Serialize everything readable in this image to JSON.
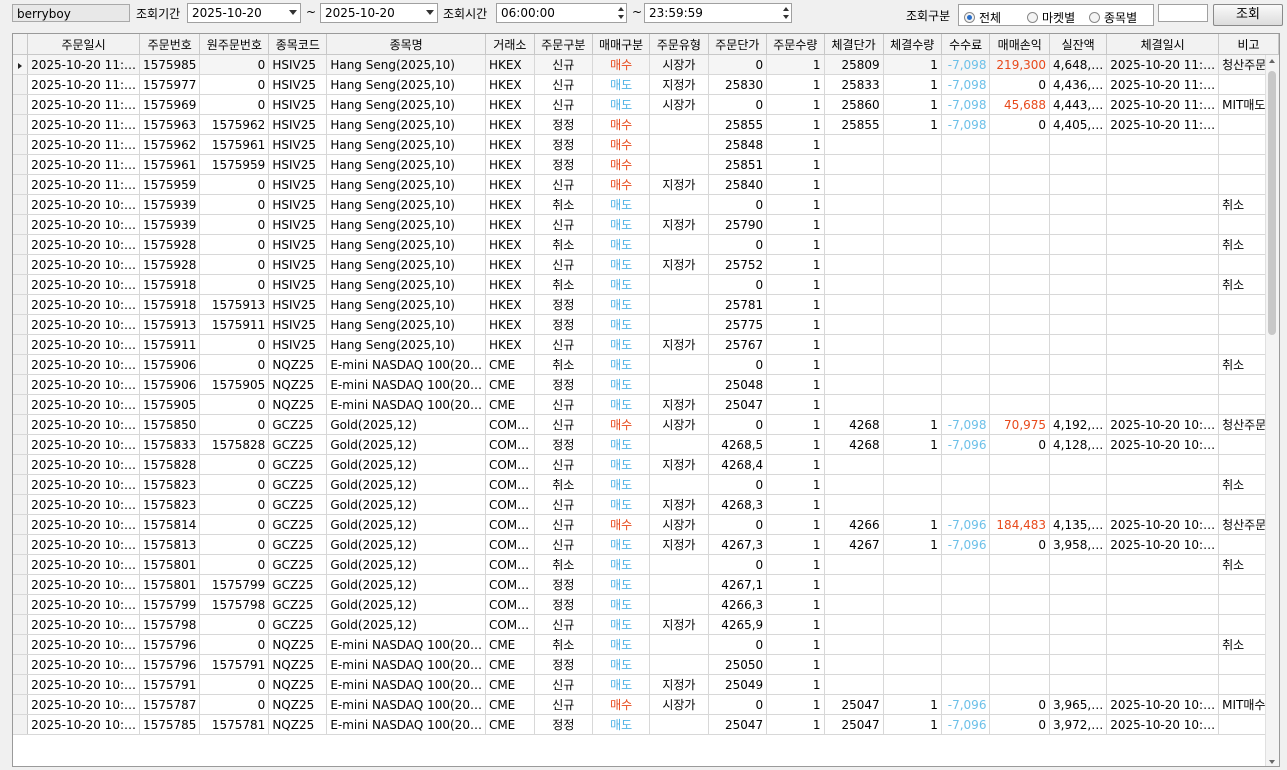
{
  "toolbar": {
    "account": "berryboy",
    "period_label": "조회기간",
    "date_from": "2025-10-20",
    "tilde": "~",
    "date_to": "2025-10-20",
    "time_label": "조회시간",
    "time_from": "06:00:00",
    "time_to": "23:59:59",
    "category_label": "조회구분",
    "radio_all": "전체",
    "radio_market": "마켓별",
    "radio_symbol": "종목별",
    "search_button": "조회"
  },
  "colors": {
    "buy": "#e8491b",
    "sell": "#4fb3e6",
    "fee": "#6cc0e8"
  },
  "columns": [
    "주문일시",
    "주문번호",
    "원주문번호",
    "종목코드",
    "종목명",
    "거래소",
    "주문구분",
    "매매구분",
    "주문유형",
    "주문단가",
    "주문수량",
    "체결단가",
    "체결수량",
    "수수료",
    "매매손익",
    "실잔액",
    "체결일시",
    "비고"
  ],
  "rows": [
    [
      "2025-10-20 11:…",
      "1575985",
      "0",
      "HSIV25",
      "Hang Seng(2025,10)",
      "HKEX",
      "신규",
      "매수",
      "시장가",
      "0",
      "1",
      "25809",
      "1",
      "-7,098",
      "219,300",
      "4,648,…",
      "2025-10-20 11:…",
      "청산주문"
    ],
    [
      "2025-10-20 11:…",
      "1575977",
      "0",
      "HSIV25",
      "Hang Seng(2025,10)",
      "HKEX",
      "신규",
      "매도",
      "지정가",
      "25830",
      "1",
      "25833",
      "1",
      "-7,098",
      "0",
      "4,436,…",
      "2025-10-20 11:…",
      ""
    ],
    [
      "2025-10-20 11:…",
      "1575969",
      "0",
      "HSIV25",
      "Hang Seng(2025,10)",
      "HKEX",
      "신규",
      "매도",
      "시장가",
      "0",
      "1",
      "25860",
      "1",
      "-7,098",
      "45,688",
      "4,443,…",
      "2025-10-20 11:…",
      "MIT매도"
    ],
    [
      "2025-10-20 11:…",
      "1575963",
      "1575962",
      "HSIV25",
      "Hang Seng(2025,10)",
      "HKEX",
      "정정",
      "매수",
      "",
      "25855",
      "1",
      "25855",
      "1",
      "-7,098",
      "0",
      "4,405,…",
      "2025-10-20 11:…",
      ""
    ],
    [
      "2025-10-20 11:…",
      "1575962",
      "1575961",
      "HSIV25",
      "Hang Seng(2025,10)",
      "HKEX",
      "정정",
      "매수",
      "",
      "25848",
      "1",
      "",
      "",
      "",
      "",
      "",
      "",
      ""
    ],
    [
      "2025-10-20 11:…",
      "1575961",
      "1575959",
      "HSIV25",
      "Hang Seng(2025,10)",
      "HKEX",
      "정정",
      "매수",
      "",
      "25851",
      "1",
      "",
      "",
      "",
      "",
      "",
      "",
      ""
    ],
    [
      "2025-10-20 11:…",
      "1575959",
      "0",
      "HSIV25",
      "Hang Seng(2025,10)",
      "HKEX",
      "신규",
      "매수",
      "지정가",
      "25840",
      "1",
      "",
      "",
      "",
      "",
      "",
      "",
      ""
    ],
    [
      "2025-10-20 10:…",
      "1575939",
      "0",
      "HSIV25",
      "Hang Seng(2025,10)",
      "HKEX",
      "취소",
      "매도",
      "",
      "0",
      "1",
      "",
      "",
      "",
      "",
      "",
      "",
      "취소"
    ],
    [
      "2025-10-20 10:…",
      "1575939",
      "0",
      "HSIV25",
      "Hang Seng(2025,10)",
      "HKEX",
      "신규",
      "매도",
      "지정가",
      "25790",
      "1",
      "",
      "",
      "",
      "",
      "",
      "",
      ""
    ],
    [
      "2025-10-20 10:…",
      "1575928",
      "0",
      "HSIV25",
      "Hang Seng(2025,10)",
      "HKEX",
      "취소",
      "매도",
      "",
      "0",
      "1",
      "",
      "",
      "",
      "",
      "",
      "",
      "취소"
    ],
    [
      "2025-10-20 10:…",
      "1575928",
      "0",
      "HSIV25",
      "Hang Seng(2025,10)",
      "HKEX",
      "신규",
      "매도",
      "지정가",
      "25752",
      "1",
      "",
      "",
      "",
      "",
      "",
      "",
      ""
    ],
    [
      "2025-10-20 10:…",
      "1575918",
      "0",
      "HSIV25",
      "Hang Seng(2025,10)",
      "HKEX",
      "취소",
      "매도",
      "",
      "0",
      "1",
      "",
      "",
      "",
      "",
      "",
      "",
      "취소"
    ],
    [
      "2025-10-20 10:…",
      "1575918",
      "1575913",
      "HSIV25",
      "Hang Seng(2025,10)",
      "HKEX",
      "정정",
      "매도",
      "",
      "25781",
      "1",
      "",
      "",
      "",
      "",
      "",
      "",
      ""
    ],
    [
      "2025-10-20 10:…",
      "1575913",
      "1575911",
      "HSIV25",
      "Hang Seng(2025,10)",
      "HKEX",
      "정정",
      "매도",
      "",
      "25775",
      "1",
      "",
      "",
      "",
      "",
      "",
      "",
      ""
    ],
    [
      "2025-10-20 10:…",
      "1575911",
      "0",
      "HSIV25",
      "Hang Seng(2025,10)",
      "HKEX",
      "신규",
      "매도",
      "지정가",
      "25767",
      "1",
      "",
      "",
      "",
      "",
      "",
      "",
      ""
    ],
    [
      "2025-10-20 10:…",
      "1575906",
      "0",
      "NQZ25",
      "E-mini NASDAQ 100(20…",
      "CME",
      "취소",
      "매도",
      "",
      "0",
      "1",
      "",
      "",
      "",
      "",
      "",
      "",
      "취소"
    ],
    [
      "2025-10-20 10:…",
      "1575906",
      "1575905",
      "NQZ25",
      "E-mini NASDAQ 100(20…",
      "CME",
      "정정",
      "매도",
      "",
      "25048",
      "1",
      "",
      "",
      "",
      "",
      "",
      "",
      ""
    ],
    [
      "2025-10-20 10:…",
      "1575905",
      "0",
      "NQZ25",
      "E-mini NASDAQ 100(20…",
      "CME",
      "신규",
      "매도",
      "지정가",
      "25047",
      "1",
      "",
      "",
      "",
      "",
      "",
      "",
      ""
    ],
    [
      "2025-10-20 10:…",
      "1575850",
      "0",
      "GCZ25",
      "Gold(2025,12)",
      "COM…",
      "신규",
      "매수",
      "시장가",
      "0",
      "1",
      "4268",
      "1",
      "-7,098",
      "70,975",
      "4,192,…",
      "2025-10-20 10:…",
      "청산주문"
    ],
    [
      "2025-10-20 10:…",
      "1575833",
      "1575828",
      "GCZ25",
      "Gold(2025,12)",
      "COM…",
      "정정",
      "매도",
      "",
      "4268,5",
      "1",
      "4268",
      "1",
      "-7,096",
      "0",
      "4,128,…",
      "2025-10-20 10:…",
      ""
    ],
    [
      "2025-10-20 10:…",
      "1575828",
      "0",
      "GCZ25",
      "Gold(2025,12)",
      "COM…",
      "신규",
      "매도",
      "지정가",
      "4268,4",
      "1",
      "",
      "",
      "",
      "",
      "",
      "",
      ""
    ],
    [
      "2025-10-20 10:…",
      "1575823",
      "0",
      "GCZ25",
      "Gold(2025,12)",
      "COM…",
      "취소",
      "매도",
      "",
      "0",
      "1",
      "",
      "",
      "",
      "",
      "",
      "",
      "취소"
    ],
    [
      "2025-10-20 10:…",
      "1575823",
      "0",
      "GCZ25",
      "Gold(2025,12)",
      "COM…",
      "신규",
      "매도",
      "지정가",
      "4268,3",
      "1",
      "",
      "",
      "",
      "",
      "",
      "",
      ""
    ],
    [
      "2025-10-20 10:…",
      "1575814",
      "0",
      "GCZ25",
      "Gold(2025,12)",
      "COM…",
      "신규",
      "매수",
      "시장가",
      "0",
      "1",
      "4266",
      "1",
      "-7,096",
      "184,483",
      "4,135,…",
      "2025-10-20 10:…",
      "청산주문"
    ],
    [
      "2025-10-20 10:…",
      "1575813",
      "0",
      "GCZ25",
      "Gold(2025,12)",
      "COM…",
      "신규",
      "매도",
      "지정가",
      "4267,3",
      "1",
      "4267",
      "1",
      "-7,096",
      "0",
      "3,958,…",
      "2025-10-20 10:…",
      ""
    ],
    [
      "2025-10-20 10:…",
      "1575801",
      "0",
      "GCZ25",
      "Gold(2025,12)",
      "COM…",
      "취소",
      "매도",
      "",
      "0",
      "1",
      "",
      "",
      "",
      "",
      "",
      "",
      "취소"
    ],
    [
      "2025-10-20 10:…",
      "1575801",
      "1575799",
      "GCZ25",
      "Gold(2025,12)",
      "COM…",
      "정정",
      "매도",
      "",
      "4267,1",
      "1",
      "",
      "",
      "",
      "",
      "",
      "",
      ""
    ],
    [
      "2025-10-20 10:…",
      "1575799",
      "1575798",
      "GCZ25",
      "Gold(2025,12)",
      "COM…",
      "정정",
      "매도",
      "",
      "4266,3",
      "1",
      "",
      "",
      "",
      "",
      "",
      "",
      ""
    ],
    [
      "2025-10-20 10:…",
      "1575798",
      "0",
      "GCZ25",
      "Gold(2025,12)",
      "COM…",
      "신규",
      "매도",
      "지정가",
      "4265,9",
      "1",
      "",
      "",
      "",
      "",
      "",
      "",
      ""
    ],
    [
      "2025-10-20 10:…",
      "1575796",
      "0",
      "NQZ25",
      "E-mini NASDAQ 100(20…",
      "CME",
      "취소",
      "매도",
      "",
      "0",
      "1",
      "",
      "",
      "",
      "",
      "",
      "",
      "취소"
    ],
    [
      "2025-10-20 10:…",
      "1575796",
      "1575791",
      "NQZ25",
      "E-mini NASDAQ 100(20…",
      "CME",
      "정정",
      "매도",
      "",
      "25050",
      "1",
      "",
      "",
      "",
      "",
      "",
      "",
      ""
    ],
    [
      "2025-10-20 10:…",
      "1575791",
      "0",
      "NQZ25",
      "E-mini NASDAQ 100(20…",
      "CME",
      "신규",
      "매도",
      "지정가",
      "25049",
      "1",
      "",
      "",
      "",
      "",
      "",
      "",
      ""
    ],
    [
      "2025-10-20 10:…",
      "1575787",
      "0",
      "NQZ25",
      "E-mini NASDAQ 100(20…",
      "CME",
      "신규",
      "매수",
      "시장가",
      "0",
      "1",
      "25047",
      "1",
      "-7,096",
      "0",
      "3,965,…",
      "2025-10-20 10:…",
      "MIT매수"
    ],
    [
      "2025-10-20 10:…",
      "1575785",
      "1575781",
      "NQZ25",
      "E-mini NASDAQ 100(20…",
      "CME",
      "정정",
      "매도",
      "",
      "25047",
      "1",
      "25047",
      "1",
      "-7,096",
      "0",
      "3,972,…",
      "2025-10-20 10:…",
      ""
    ]
  ]
}
